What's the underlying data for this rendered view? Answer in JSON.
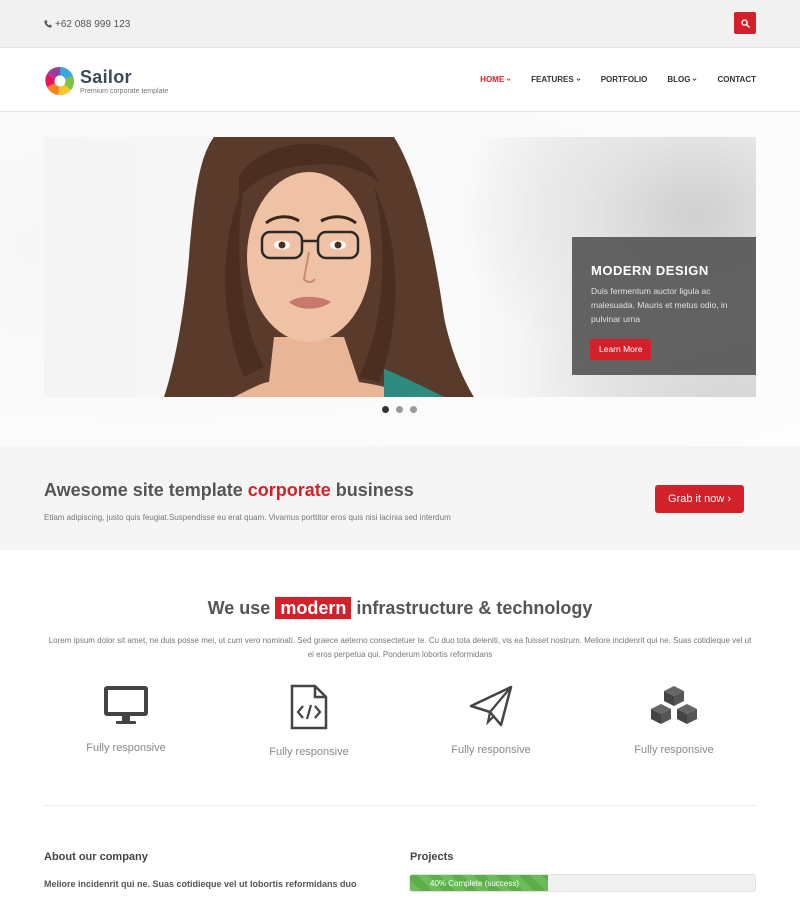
{
  "topbar": {
    "phone": "+62 088 999 123",
    "search_icon": "search-icon"
  },
  "header": {
    "brand": "Sailor",
    "tagline": "Premium corporate template",
    "nav": [
      {
        "label": "HOME",
        "dropdown": true,
        "active": true
      },
      {
        "label": "FEATURES",
        "dropdown": true,
        "active": false
      },
      {
        "label": "PORTFOLIO",
        "dropdown": false,
        "active": false
      },
      {
        "label": "BLOG",
        "dropdown": true,
        "active": false
      },
      {
        "label": "CONTACT",
        "dropdown": false,
        "active": false
      }
    ]
  },
  "slider": {
    "caption_title": "MODERN DESIGN",
    "caption_text": "Duis fermentum auctor ligula ac malesuada. Mauris et metus odio, in pulvinar urna",
    "button": "Learn More",
    "dots": [
      true,
      false,
      false
    ]
  },
  "cta": {
    "title_pre": "Awesome site template ",
    "title_highlight": "corporate",
    "title_post": " business",
    "subtitle": "Etiam adipiscing, justo quis feugiat.Suspendisse eu erat quam. Vivamus porttitor eros quis nisi lacinia sed interdum",
    "button": "Grab it now ›"
  },
  "features": {
    "title_pre": "We use ",
    "title_highlight": "modern",
    "title_post": " infrastructure & technology",
    "description": "Lorem ipsum dolor sit amet, ne duis posse mei, ut cum vero nominati. Sed graece aeterno consectetuer te. Cu duo tota deleniti, vis ea fuisset nostrum. Meliore incidenrit qui ne. Suas cotidieque vel ut ei eros perpetua qui. Ponderum lobortis reformidans",
    "items": [
      {
        "icon": "monitor-icon",
        "label": "Fully responsive"
      },
      {
        "icon": "code-file-icon",
        "label": "Fully responsive"
      },
      {
        "icon": "paper-plane-icon",
        "label": "Fully responsive"
      },
      {
        "icon": "cubes-icon",
        "label": "Fully responsive"
      }
    ]
  },
  "about": {
    "title": "About our company",
    "text": "Meliore incidenrit qui ne. Suas cotidieque vel ut lobortis reformidans duo"
  },
  "projects": {
    "title": "Projects",
    "progress_label": "40% Complete (success)",
    "progress_percent": 40
  },
  "colors": {
    "accent": "#d3212b",
    "success": "#5cae49"
  }
}
